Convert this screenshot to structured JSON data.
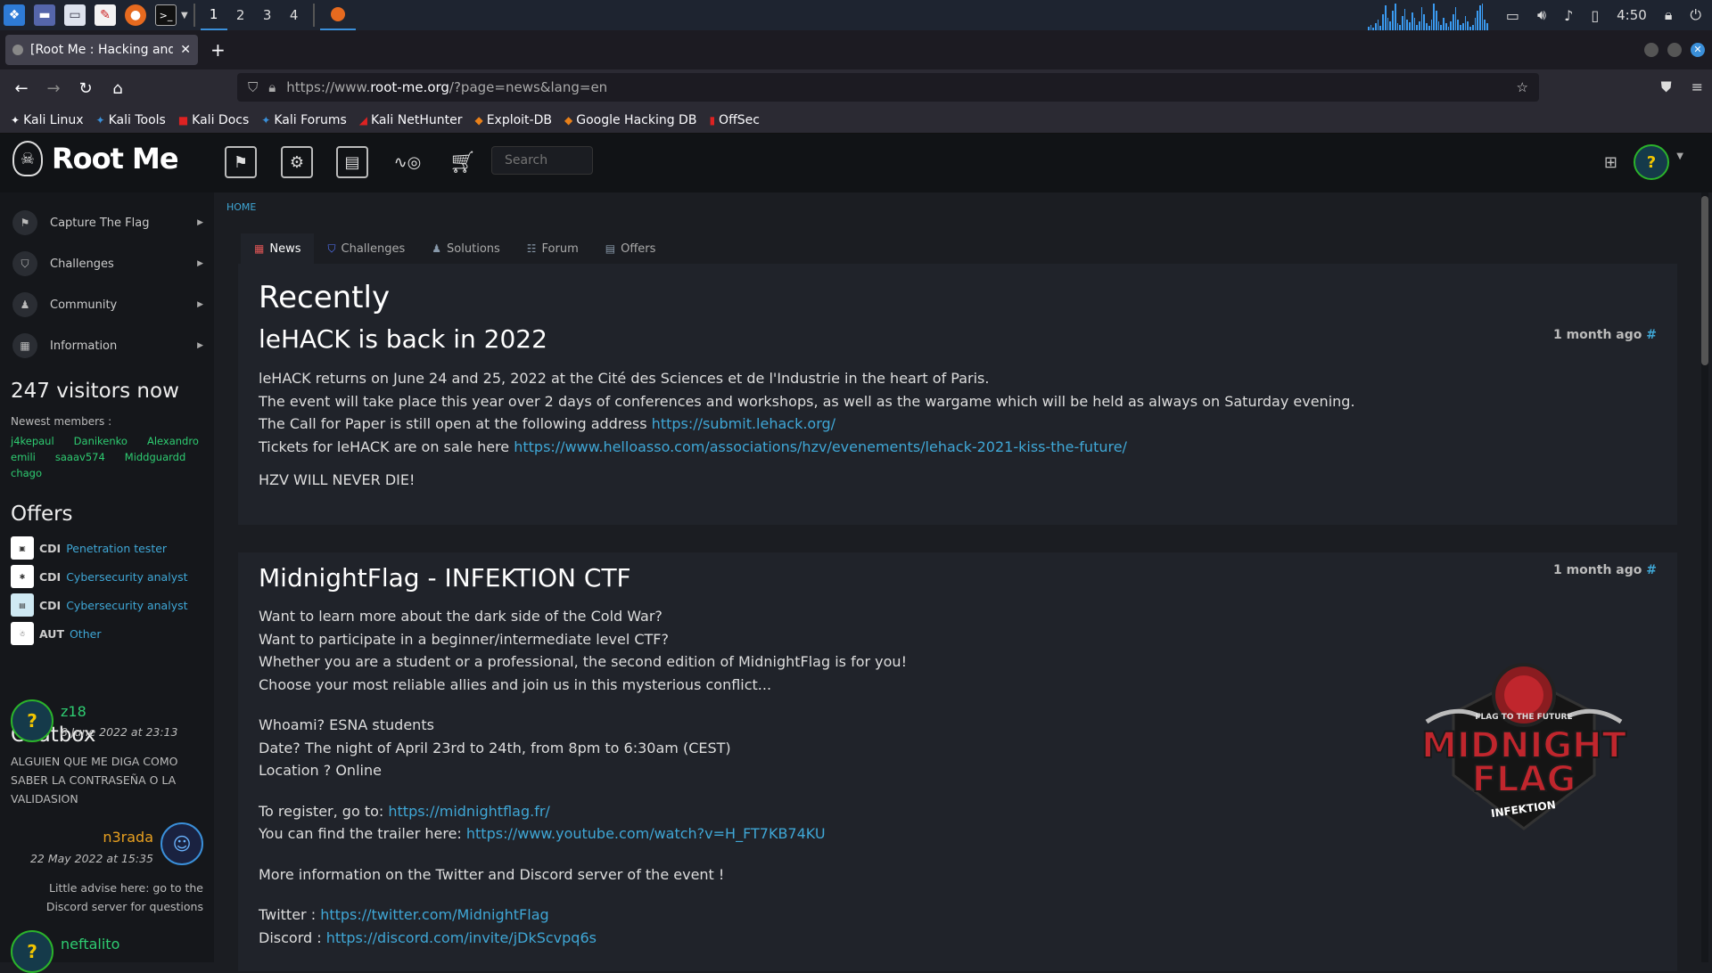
{
  "taskbar": {
    "workspaces": [
      "1",
      "2",
      "3",
      "4"
    ],
    "clock": "4:50",
    "cpu_bars": [
      4,
      6,
      3,
      8,
      12,
      5,
      18,
      28,
      14,
      10,
      22,
      30,
      8,
      6,
      16,
      24,
      12,
      9,
      20,
      14,
      6,
      10,
      26,
      18,
      8,
      5,
      12,
      30,
      22,
      10,
      6,
      14,
      8,
      4,
      10,
      18,
      26,
      12,
      6,
      8,
      16,
      10,
      4,
      6,
      14,
      22,
      28,
      30,
      12,
      8
    ]
  },
  "browser": {
    "tab_title": "[Root Me : Hacking and In",
    "url_prefix": "https://www.",
    "url_domain": "root-me.org",
    "url_rest": "/?page=news&lang=en",
    "bookmarks": [
      "Kali Linux",
      "Kali Tools",
      "Kali Docs",
      "Kali Forums",
      "Kali NetHunter",
      "Exploit-DB",
      "Google Hacking DB",
      "OffSec"
    ]
  },
  "site": {
    "logo_text": "Root Me",
    "search_placeholder": "Search",
    "breadcrumb": "HOME",
    "sidebar": {
      "items": [
        {
          "label": "Capture The Flag"
        },
        {
          "label": "Challenges"
        },
        {
          "label": "Community"
        },
        {
          "label": "Information"
        }
      ],
      "visitors": "247 visitors now",
      "newest_label": "Newest members :",
      "members": [
        "j4kepaul",
        "Danikenko",
        "Alexandro",
        "emili",
        "saaav574",
        "Middguardd",
        "chago"
      ],
      "offers_heading": "Offers",
      "offers": [
        {
          "type": "CDI",
          "title": "Penetration tester"
        },
        {
          "type": "CDI",
          "title": "Cybersecurity analyst"
        },
        {
          "type": "CDI",
          "title": "Cybersecurity analyst"
        },
        {
          "type": "AUT",
          "title": "Other"
        }
      ],
      "chat_heading": "Chatbox",
      "chat": [
        {
          "user": "z18",
          "date": "8 June 2022 at 23:13",
          "message": "ALGUIEN QUE ME DIGA COMO SABER LA CONTRASEÑA O LA VALIDASION"
        },
        {
          "user": "n3rada",
          "date": "22 May 2022 at 15:35",
          "message": "Little advise here: go to the Discord server for questions"
        },
        {
          "user": "neftalito"
        }
      ]
    },
    "tabs": [
      "News",
      "Challenges",
      "Solutions",
      "Forum",
      "Offers"
    ],
    "recent_heading": "Recently",
    "news": [
      {
        "title": "leHACK is back in 2022",
        "meta": "1 month ago",
        "hash": "#",
        "lines": [
          "leHACK returns on June 24 and 25, 2022 at the Cité des Sciences et de l'Industrie in the heart of Paris.",
          "The event will take place this year over 2 days of conferences and workshops, as well as the wargame which will be held as always on Saturday evening.",
          "The Call for Paper is still open at the following address ",
          "Tickets for leHACK are on sale here "
        ],
        "link_cfp": "https://submit.lehack.org/",
        "link_tickets": "https://www.helloasso.com/associations/hzv/evenements/lehack-2021-kiss-the-future/",
        "closing": "HZV WILL NEVER DIE!"
      },
      {
        "title": "MidnightFlag - INFEKTION CTF",
        "meta": "1 month ago",
        "hash": "#",
        "intro": [
          "Want to learn more about the dark side of the Cold War?",
          "Want to participate in a beginner/intermediate level CTF?",
          "Whether you are a student or a professional, the second edition of MidnightFlag is for you!",
          "Choose your most reliable allies and join us in this mysterious conflict..."
        ],
        "details": [
          "Whoami? ESNA students",
          "Date? The night of April 23rd to 24th, from 8pm to 6:30am (CEST)",
          "Location ? Online"
        ],
        "register_label": "To register, go to: ",
        "register_link": "https://midnightflag.fr/",
        "trailer_label": "You can find the trailer here: ",
        "trailer_link": "https://www.youtube.com/watch?v=H_FT7KB74KU",
        "more_info": "More information on the Twitter and Discord server of the event !",
        "twitter_label": "Twitter : ",
        "twitter_link": "https://twitter.com/MidnightFlag",
        "discord_label": "Discord : ",
        "discord_link": "https://discord.com/invite/jDkScvpq6s",
        "logo": {
          "top_text": "FLAG TO THE FUTURE",
          "main_1": "MIDNIGHT",
          "main_2": "FLAG",
          "sub": "INFEKTION"
        }
      }
    ]
  },
  "colors": {
    "accent": "#3fa7d6",
    "member_green": "#2ecc71",
    "user_orange": "#e8a020",
    "logo_red": "#c0262d"
  }
}
